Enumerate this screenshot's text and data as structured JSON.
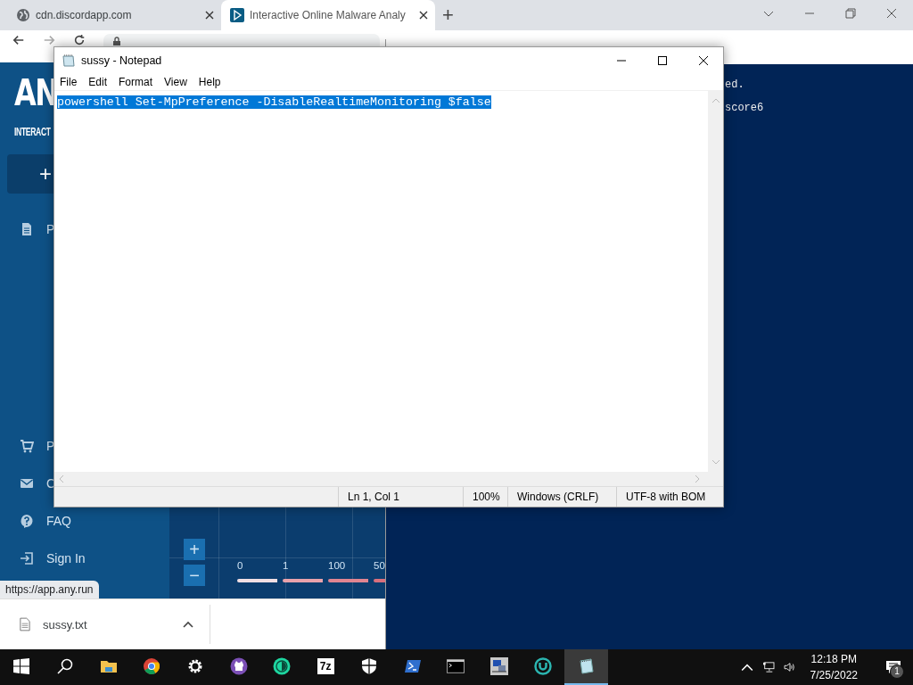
{
  "browser": {
    "tabs": [
      {
        "title": "cdn.discordapp.com",
        "kind": "globe",
        "selected": false
      },
      {
        "title": "Interactive Online Malware Analy",
        "kind": "anyrun",
        "selected": true
      }
    ],
    "new_tab": "+",
    "status_url": "https://app.any.run",
    "download": {
      "filename": "sussy.txt"
    }
  },
  "page": {
    "logo": "AN",
    "tagline": "INTERACT",
    "new_task": "+",
    "nav_top": [
      {
        "label": "P",
        "kind": "doc"
      }
    ],
    "nav_bottom": [
      {
        "label": "P",
        "kind": "cart"
      },
      {
        "label": "C",
        "kind": "mail"
      },
      {
        "label": "FAQ",
        "kind": "help"
      },
      {
        "label": "Sign In",
        "kind": "signin"
      }
    ],
    "zoom_in": "+",
    "zoom_out": "−",
    "legend": [
      {
        "label": "0",
        "color": "#f2dfe3"
      },
      {
        "label": "1",
        "color": "#e9a2ab"
      },
      {
        "label": "100",
        "color": "#e08591"
      },
      {
        "label": "50",
        "color": "#d9707d"
      }
    ]
  },
  "powershell": {
    "lines": [
      "ed.",
      "score6"
    ]
  },
  "notepad": {
    "title": "sussy - Notepad",
    "menu": [
      "File",
      "Edit",
      "Format",
      "View",
      "Help"
    ],
    "text": "powershell Set-MpPreference -DisableRealtimeMonitoring $false",
    "text_selected": true,
    "status": [
      "Ln 1, Col 1",
      "100%",
      "Windows (CRLF)",
      "UTF-8 with BOM"
    ]
  },
  "taskbar": {
    "items": [
      {
        "kind": "start",
        "active": false
      },
      {
        "kind": "search",
        "active": false
      },
      {
        "kind": "folder",
        "active": false
      },
      {
        "kind": "chrome",
        "active": false
      },
      {
        "kind": "settings",
        "active": false
      },
      {
        "kind": "github",
        "active": false
      },
      {
        "kind": "tor",
        "active": false
      },
      {
        "kind": "sevenzip",
        "label": "7z",
        "active": false
      },
      {
        "kind": "shield",
        "active": false
      },
      {
        "kind": "powershell",
        "active": false
      },
      {
        "kind": "terminal",
        "active": false
      },
      {
        "kind": "computer",
        "active": false
      },
      {
        "kind": "ring",
        "active": false
      },
      {
        "kind": "notepad",
        "active": true
      }
    ],
    "time": "12:18 PM",
    "date": "7/25/2022",
    "notifications": "1"
  }
}
